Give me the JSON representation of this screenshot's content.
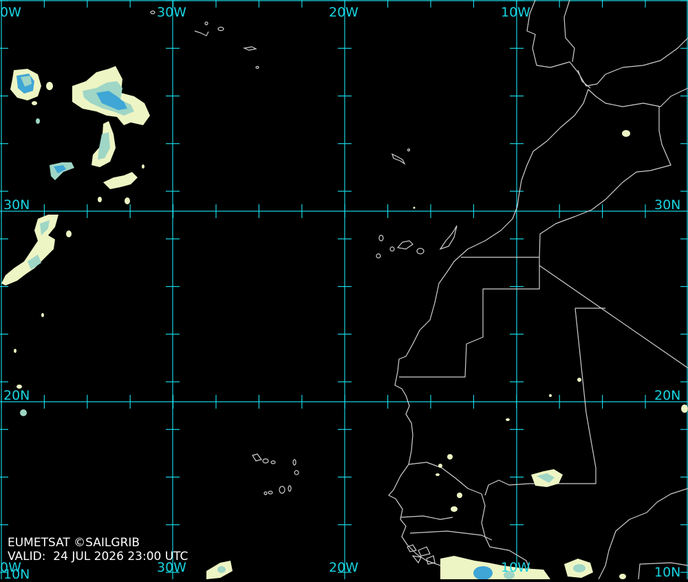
{
  "credit": {
    "source": "EUMETSAT ©SAILGRIB",
    "valid_prefix": "VALID:",
    "valid_time": "24 JUL 2026 23:00 UTC"
  },
  "labels": {
    "lon_40w_top": "0W",
    "lon_30w_top": "30W",
    "lon_20w_top": "20W",
    "lon_10w_top": "10W",
    "lon_40w_bottom": "0W",
    "lon_30w_bottom": "30W",
    "lon_20w_bottom": "20W",
    "lon_10w_bottom": "10W",
    "lat_30n_left": "30N",
    "lat_30n_right": "30N",
    "lat_20n_left": "20N",
    "lat_20n_right": "20N",
    "lat_10n_left": "10N",
    "lat_10n_right": "10N"
  },
  "colors": {
    "background": "#000000",
    "grid": "#19d3e0",
    "coastline": "#d0d0d0",
    "cloud_light": "#eef5c4",
    "cloud_mid": "#9fd6c6",
    "cloud_dense": "#3fa6d6"
  }
}
